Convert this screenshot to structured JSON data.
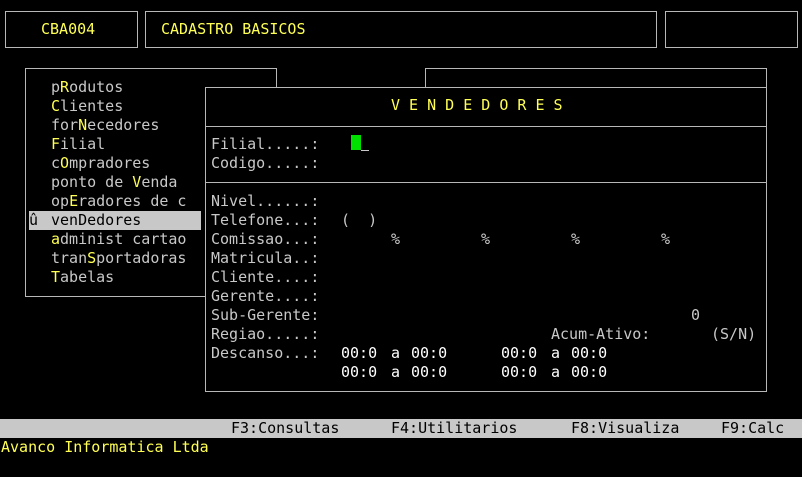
{
  "header": {
    "code": "CBA004",
    "title": "CADASTRO BASICOS",
    "right_box": ""
  },
  "menu": {
    "items": [
      {
        "pre": "p",
        "hot": "R",
        "post": "odutos",
        "selected": false,
        "marker": ""
      },
      {
        "pre": "",
        "hot": "C",
        "post": "lientes",
        "selected": false,
        "marker": ""
      },
      {
        "pre": "for",
        "hot": "N",
        "post": "ecedores",
        "selected": false,
        "marker": ""
      },
      {
        "pre": "",
        "hot": "F",
        "post": "ilial",
        "selected": false,
        "marker": ""
      },
      {
        "pre": "c",
        "hot": "O",
        "post": "mpradores",
        "selected": false,
        "marker": ""
      },
      {
        "pre": "ponto de ",
        "hot": "V",
        "post": "enda",
        "selected": false,
        "marker": ""
      },
      {
        "pre": "op",
        "hot": "E",
        "post": "radores de c",
        "selected": false,
        "marker": ""
      },
      {
        "pre": "ven",
        "hot": "D",
        "post": "edores",
        "selected": true,
        "marker": "û"
      },
      {
        "pre": "",
        "hot": "a",
        "post": "dminist cartao",
        "selected": false,
        "marker": ""
      },
      {
        "pre": "tran",
        "hot": "S",
        "post": "portadoras",
        "selected": false,
        "marker": ""
      },
      {
        "pre": "",
        "hot": "T",
        "post": "abelas",
        "selected": false,
        "marker": ""
      }
    ]
  },
  "form": {
    "title": "V E N D E D O R E S",
    "filial_label": "Filial.....:",
    "codigo_label": "Codigo.....:",
    "nivel_label": "Nivel......:",
    "telefone_label": "Telefone...:",
    "telefone_value": "(  )",
    "comissao_label": "Comissao...:",
    "comissao_units": [
      "%",
      "%",
      "%",
      "%"
    ],
    "matricula_label": "Matricula..:",
    "cliente_label": "Cliente....:",
    "gerente_label": "Gerente....:",
    "subgerente_label": "Sub-Gerente:",
    "subgerente_value": "0",
    "regiao_label": "Regiao.....:",
    "acum_label": "Acum-Ativo:",
    "acum_hint": "(S/N)",
    "descanso_label": "Descanso...:",
    "descanso_rows": [
      {
        "a_from": "00:0",
        "a_sep": "a",
        "a_to": "00:0",
        "b_from": "00:0",
        "b_sep": "a",
        "b_to": "00:0"
      },
      {
        "a_from": "00:0",
        "a_sep": "a",
        "a_to": "00:0",
        "b_from": "00:0",
        "b_sep": "a",
        "b_to": "00:0"
      }
    ]
  },
  "status_bar": {
    "f3": "F3:Consultas",
    "f4": "F4:Utilitarios",
    "f8": "F8:Visualiza",
    "f9": "F9:Calc"
  },
  "footer": {
    "company": "Avanco Informatica Ltda"
  },
  "colors": {
    "background": "#000000",
    "text": "#c8c8c8",
    "accent": "#ffff55",
    "cursor": "#00e000",
    "status_bar": "#c8c8c8"
  }
}
